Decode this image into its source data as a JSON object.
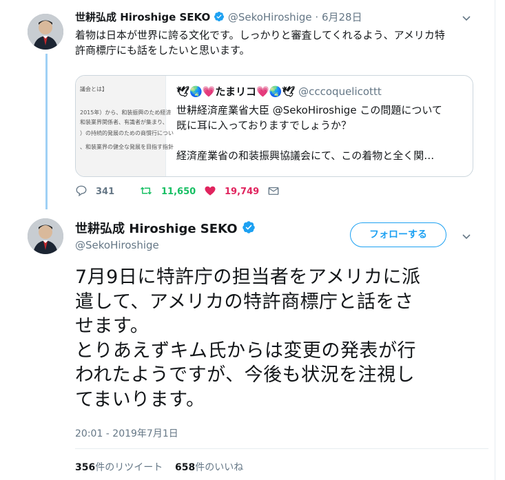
{
  "colors": {
    "accent": "#1da1f2",
    "retweet_green": "#17bf63",
    "like_red": "#e0245e",
    "thread_line": "#9fd0f5",
    "muted": "#657786"
  },
  "tweet1": {
    "name": "世耕弘成 Hiroshige SEKO",
    "handle": "@SekoHiroshige",
    "date": "6月28日",
    "text_line1": "着物は日本が世界に誇る文化です。しっかりと審査してくれるよう、アメリカ特",
    "text_line2": "許商標庁にも話をしたいと思います。",
    "quote": {
      "name": "🕊🌏💗たまリコ💗🌏🕊",
      "handle": "@cccoquelicottt",
      "line1": "世耕経済産業省大臣 @SekoHiroshige この問題について",
      "line2": "既に耳に入っておりますでしょうか？",
      "line3": "経済産業省の和装振興協議会にて、この着物と全く関…",
      "image_lines": [
        "議会とは】",
        "2015年）から、和装振興のため経済",
        "和装業界関係者、有識者が集まり、",
        "）の持続的発展のための商慣行につい",
        "、和装業界の健全な発展を目指す指針"
      ]
    },
    "actions": {
      "replies": "341",
      "retweets": "11,650",
      "likes": "19,749"
    },
    "icons": {
      "reply": "reply-icon",
      "retweet": "retweet-icon",
      "like": "heart-icon",
      "dm": "envelope-icon",
      "more": "chevron-down-icon",
      "verified": "verified-badge-icon"
    }
  },
  "tweet2": {
    "name": "世耕弘成 Hiroshige SEKO",
    "handle": "@SekoHiroshige",
    "follow_label": "フォローする",
    "text_lines": [
      "7月9日に特許庁の担当者をアメリカに派",
      "遣して、アメリカの特許商標庁と話をさ",
      "せます。",
      "とりあえずキム氏からは変更の発表が行",
      "われたようですが、今後も状況を注視し",
      "てまいります。"
    ],
    "timestamp": "20:01 - 2019年7月1日",
    "retweet_count": "356",
    "retweet_label": "件のリツイート",
    "like_count": "658",
    "like_label": "件のいいね"
  }
}
